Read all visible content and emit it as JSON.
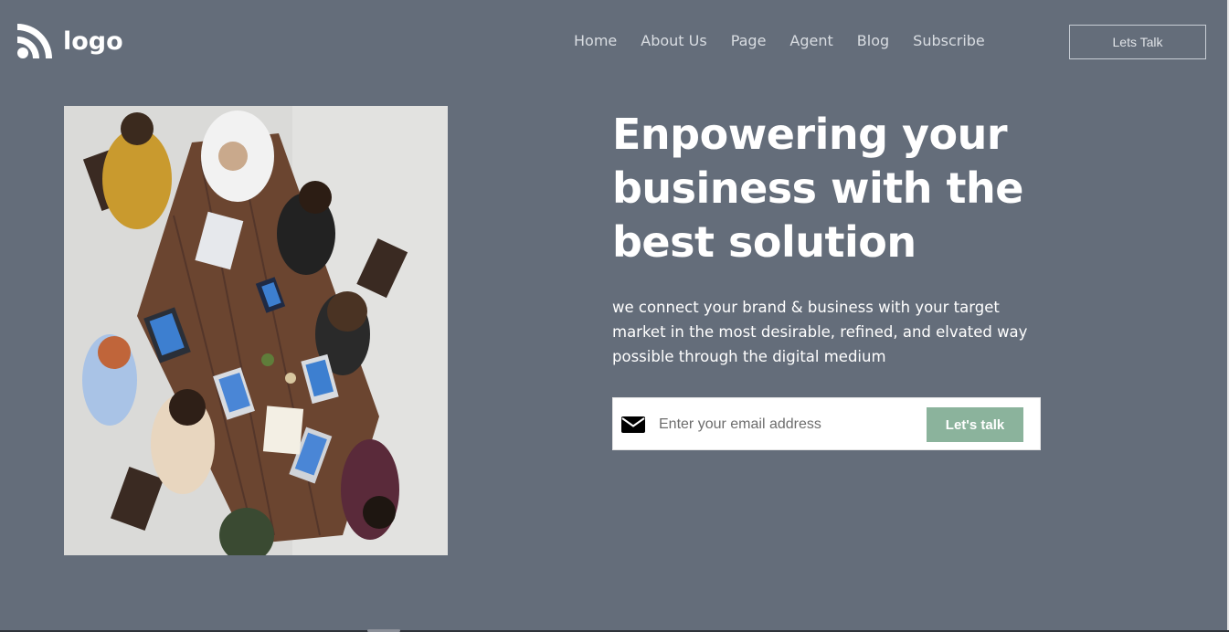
{
  "header": {
    "logo_text": "logo",
    "logo_icon": "wifi-arc-logo-icon",
    "nav": [
      "Home",
      "About Us",
      "Page",
      "Agent",
      "Blog",
      "Subscribe"
    ],
    "cta_label": "Lets Talk"
  },
  "hero": {
    "image": "team-meeting-top-view-photo",
    "headline": "Enpowering your business with the best solution",
    "subtext": "we connect your brand & business with your target market in the most desirable, refined, and elvated way possible through the digital medium",
    "email_placeholder": "Enter your email address",
    "email_value": "",
    "email_icon": "envelope-icon",
    "submit_label": "Let's talk"
  },
  "colors": {
    "page_background": "#646d7a",
    "headline_text": "#ffffff",
    "accent_button": "#8bb39c",
    "nav_text": "#d9dde2"
  }
}
